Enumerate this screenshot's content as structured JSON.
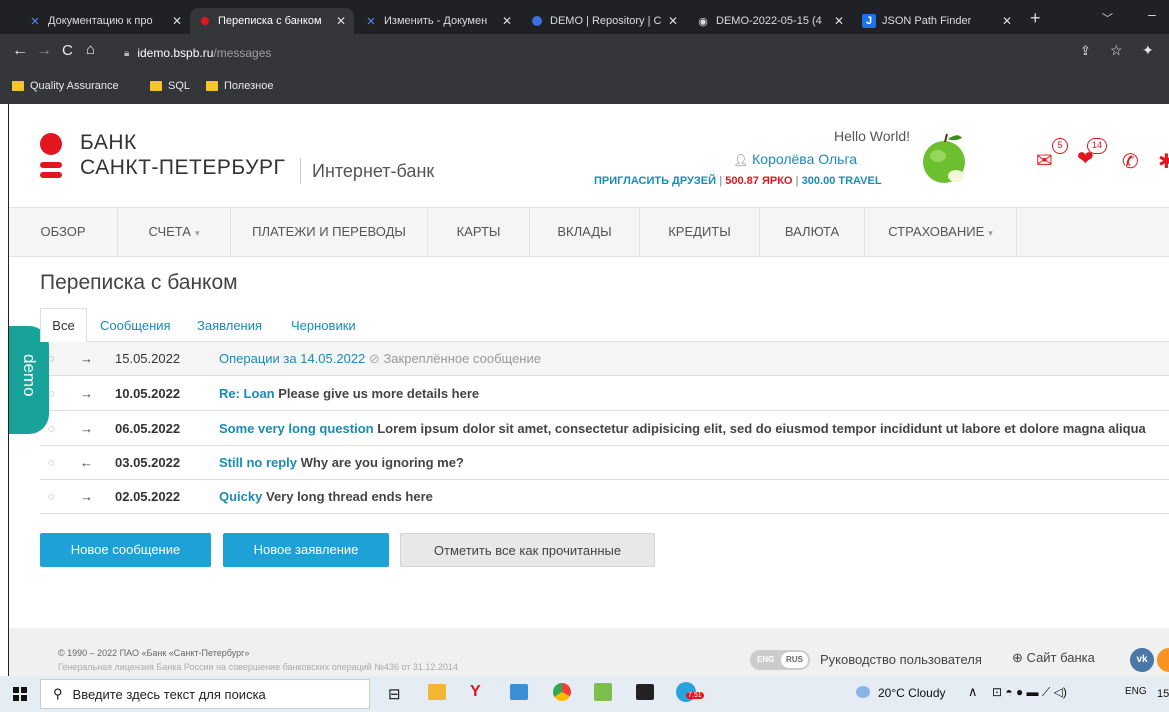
{
  "browser": {
    "tabs": [
      {
        "title": "Документацию к про",
        "icon": "confluence-icon"
      },
      {
        "title": "Переписка с банком",
        "icon": "bspb-icon"
      },
      {
        "title": "Изменить - Докумен",
        "icon": "confluence-icon"
      },
      {
        "title": "DEMO | Repository | C",
        "icon": "repo-icon"
      },
      {
        "title": "DEMO-2022-05-15 (4",
        "icon": "globe-icon"
      },
      {
        "title": "JSON Path Finder",
        "icon": "json-icon"
      }
    ],
    "url_host": "idemo.bspb.ru",
    "url_path": "/messages",
    "bookmarks": [
      "Quality Assurance",
      "SQL",
      "Полезное"
    ]
  },
  "header": {
    "bank_line1": "БАНК",
    "bank_line2": "САНКТ-ПЕТЕРБУРГ",
    "internet_bank": "Интернет-банк",
    "greeting": "Hello World!",
    "user_name": "Королёва Ольга",
    "invite": "ПРИГЛАСИТЬ ДРУЗЕЙ",
    "sep1": "|",
    "bonus1": "500.87 ЯРКО",
    "sep2": "|",
    "bonus2": "300.00 TRAVEL",
    "mail_count": "5",
    "gift_count": "14"
  },
  "nav": {
    "items": [
      "ОБЗОР",
      "СЧЕТА",
      "ПЛАТЕЖИ И ПЕРЕВОДЫ",
      "КАРТЫ",
      "ВКЛАДЫ",
      "КРЕДИТЫ",
      "ВАЛЮТА",
      "СТРАХОВАНИЕ"
    ]
  },
  "page": {
    "title": "Переписка с банком",
    "tabs": [
      "Все",
      "Сообщения",
      "Заявления",
      "Черновики"
    ],
    "demo_label": "demo"
  },
  "messages": [
    {
      "date": "15.05.2022",
      "subject": "Операции за 14.05.2022",
      "body": "",
      "pinned": "Закреплённое сообщение",
      "direction": "→",
      "read": true
    },
    {
      "date": "10.05.2022",
      "subject": "Re: Loan",
      "body": "Please give us more details here",
      "pinned": "",
      "direction": "→",
      "read": false
    },
    {
      "date": "06.05.2022",
      "subject": "Some very long question",
      "body": "Lorem ipsum dolor sit amet, consectetur adipisicing elit, sed do eiusmod tempor incididunt ut labore et dolore magna aliqua",
      "pinned": "",
      "direction": "→",
      "read": false
    },
    {
      "date": "03.05.2022",
      "subject": "Still no reply",
      "body": "Why are you ignoring me?",
      "pinned": "",
      "direction": "←",
      "read": false
    },
    {
      "date": "02.05.2022",
      "subject": "Quicky",
      "body": "Very long thread ends here",
      "pinned": "",
      "direction": "→",
      "read": false
    }
  ],
  "buttons": {
    "new_message": "Новое сообщение",
    "new_application": "Новое заявление",
    "mark_all_read": "Отметить все как прочитанные"
  },
  "footer": {
    "copyright": "© 1990 – 2022 ПАО «Банк «Санкт-Петербург»",
    "license": "Генеральная лицензия Банка России на совершение банковских операций №436 от 31.12.2014",
    "lang_eng": "ENG",
    "lang_rus": "RUS",
    "user_guide": "Руководство пользователя",
    "bank_site": "Сайт банка"
  },
  "taskbar": {
    "search_placeholder": "Введите здесь текст для поиска",
    "weather": "20°C  Cloudy",
    "lang": "ENG",
    "time": "15",
    "telegram_badge": "7.51"
  },
  "colors": {
    "brand_red": "#e3151e",
    "link_blue": "#1b8ab5",
    "button_blue": "#1ea1d6",
    "demo_teal": "#17a39a"
  }
}
